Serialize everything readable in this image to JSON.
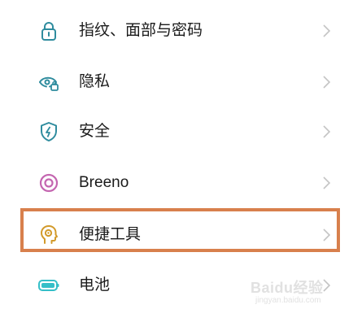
{
  "settings_items": [
    {
      "label": "指纹、面部与密码",
      "icon": "lock-icon"
    },
    {
      "label": "隐私",
      "icon": "privacy-eye-icon"
    },
    {
      "label": "安全",
      "icon": "security-shield-icon"
    },
    {
      "label": "Breeno",
      "icon": "breeno-icon"
    },
    {
      "label": "便捷工具",
      "icon": "convenience-tools-icon"
    },
    {
      "label": "电池",
      "icon": "battery-icon"
    }
  ],
  "highlighted_item": "便捷工具",
  "colors": {
    "icon_teal": "#2f8c9e",
    "breeno_purple": "#c466b0",
    "tools_gold": "#d29a2a",
    "battery_cyan": "#35bfc8",
    "highlight_border": "#d8804d",
    "chevron": "#c4c4c4",
    "label_text": "#1a1a1a"
  },
  "watermark": {
    "brand": "Baidu经验",
    "url": "jingyan.baidu.com"
  }
}
